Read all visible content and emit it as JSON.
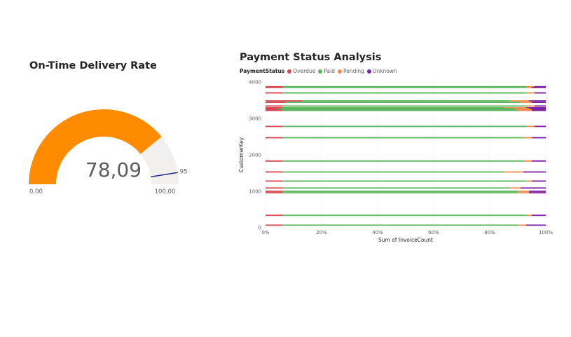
{
  "gauge": {
    "title": "On-Time Delivery Rate",
    "value": 78.09,
    "value_label": "78,09",
    "min": 0,
    "max": 100,
    "min_label": "0,00",
    "max_label": "100,00",
    "target": 95,
    "target_label": "95",
    "fill_color": "#FF8C00",
    "track_color": "#F1F0EF",
    "target_color": "#1F2D86"
  },
  "chart_data": {
    "type": "bar",
    "orientation": "horizontal",
    "stacking": "percent",
    "title": "Payment Status Analysis",
    "legend_title": "PaymentStatus",
    "legend_position": "top-left",
    "xlabel": "Sum of InvoiceCount",
    "ylabel": "CustomerKey",
    "x_ticks": [
      "0%",
      "20%",
      "40%",
      "60%",
      "80%",
      "100%"
    ],
    "y_ticks": [
      "0",
      "1000",
      "2000",
      "3000",
      "4000"
    ],
    "ylim": [
      0,
      4000
    ],
    "grid": true,
    "series": [
      {
        "name": "Overdue",
        "color": "#D64550"
      },
      {
        "name": "Paid",
        "color": "#5BB55C"
      },
      {
        "name": "Pending",
        "color": "#F28B4B"
      },
      {
        "name": "Unknown",
        "color": "#7B1FA2"
      }
    ],
    "bars": [
      {
        "key": 3870,
        "overdue": 0.06,
        "paid": 0.87,
        "pending": 0.03,
        "unknown": 0.04
      },
      {
        "key": 3850,
        "overdue": 0.06,
        "paid": 0.87,
        "pending": 0.02,
        "unknown": 0.05
      },
      {
        "key": 3700,
        "overdue": 0.06,
        "paid": 0.87,
        "pending": 0.03,
        "unknown": 0.04
      },
      {
        "key": 3480,
        "overdue": 0.13,
        "paid": 0.74,
        "pending": 0.07,
        "unknown": 0.06
      },
      {
        "key": 3440,
        "overdue": 0.07,
        "paid": 0.84,
        "pending": 0.04,
        "unknown": 0.05
      },
      {
        "key": 3340,
        "overdue": 0.06,
        "paid": 0.87,
        "pending": 0.03,
        "unknown": 0.04
      },
      {
        "key": 3290,
        "overdue": 0.06,
        "paid": 0.79,
        "pending": 0.08,
        "unknown": 0.07
      },
      {
        "key": 3270,
        "overdue": 0.05,
        "paid": 0.84,
        "pending": 0.05,
        "unknown": 0.06
      },
      {
        "key": 3240,
        "overdue": 0.04,
        "paid": 0.85,
        "pending": 0.06,
        "unknown": 0.05
      },
      {
        "key": 3220,
        "overdue": 0.06,
        "paid": 0.84,
        "pending": 0.05,
        "unknown": 0.05
      },
      {
        "key": 2780,
        "overdue": 0.06,
        "paid": 0.87,
        "pending": 0.03,
        "unknown": 0.04
      },
      {
        "key": 2470,
        "overdue": 0.06,
        "paid": 0.86,
        "pending": 0.03,
        "unknown": 0.05
      },
      {
        "key": 1830,
        "overdue": 0.06,
        "paid": 0.86,
        "pending": 0.03,
        "unknown": 0.05
      },
      {
        "key": 1530,
        "overdue": 0.06,
        "paid": 0.79,
        "pending": 0.07,
        "unknown": 0.08
      },
      {
        "key": 1280,
        "overdue": 0.06,
        "paid": 0.87,
        "pending": 0.02,
        "unknown": 0.05
      },
      {
        "key": 1090,
        "overdue": 0.06,
        "paid": 0.81,
        "pending": 0.04,
        "unknown": 0.09
      },
      {
        "key": 1000,
        "overdue": 0.06,
        "paid": 0.84,
        "pending": 0.04,
        "unknown": 0.06
      },
      {
        "key": 960,
        "overdue": 0.06,
        "paid": 0.84,
        "pending": 0.04,
        "unknown": 0.06
      },
      {
        "key": 340,
        "overdue": 0.06,
        "paid": 0.87,
        "pending": 0.02,
        "unknown": 0.05
      },
      {
        "key": 70,
        "overdue": 0.06,
        "paid": 0.84,
        "pending": 0.03,
        "unknown": 0.07
      }
    ]
  }
}
